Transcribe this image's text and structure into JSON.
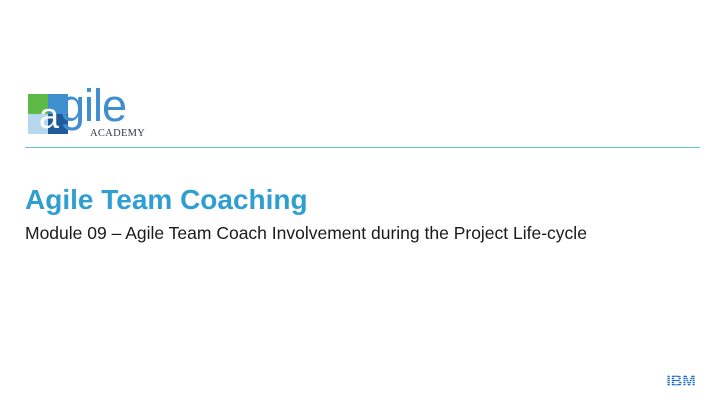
{
  "logo": {
    "word": "agile",
    "sub": "ACADEMY",
    "colors": {
      "blue": "#3f8fd0",
      "dark_blue": "#1e5a9c",
      "green": "#5fb947",
      "light": "#b7d7ee"
    }
  },
  "slide": {
    "title": "Agile Team Coaching",
    "subtitle": "Module 09 – Agile Team Coach Involvement during the Project Life-cycle"
  },
  "footer": {
    "brand_icon": "ibm-logo-icon",
    "brand_label": "IBM"
  },
  "colors": {
    "title": "#2f9fd1",
    "rule": "#5ecad4",
    "ibm": "#1f70c1"
  }
}
